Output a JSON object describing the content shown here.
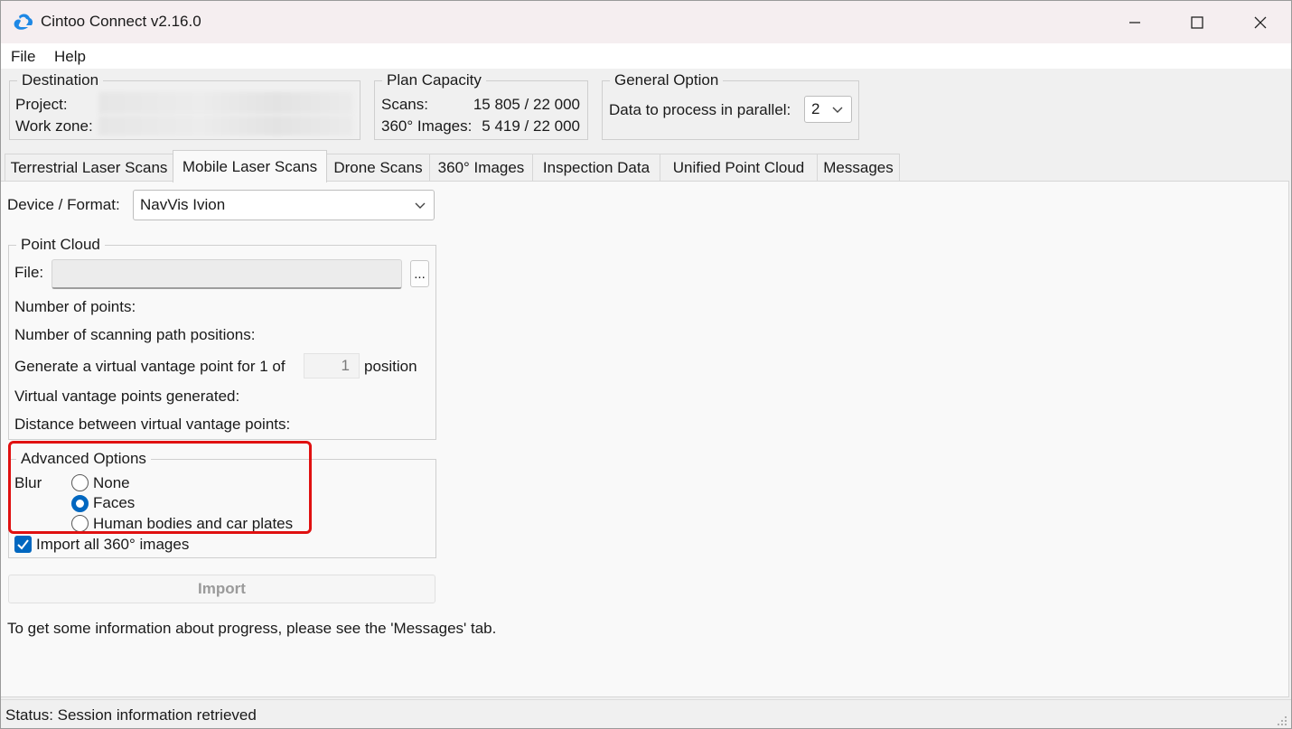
{
  "window": {
    "title": "Cintoo Connect v2.16.0",
    "colors": {
      "accent": "#0067c0",
      "highlight": "#e01010",
      "logo": "#1e88e5"
    }
  },
  "menu": {
    "file": "File",
    "help": "Help"
  },
  "destination": {
    "title": "Destination",
    "project_label": "Project:",
    "work_zone_label": "Work zone:"
  },
  "plan_capacity": {
    "title": "Plan Capacity",
    "scans_label": "Scans:",
    "scans_value": "15 805 / 22 000",
    "images_label": "360° Images:",
    "images_value": "5 419 / 22 000"
  },
  "general_option": {
    "title": "General Option",
    "parallel_label": "Data to process in parallel:",
    "parallel_value": "2"
  },
  "tabs": [
    {
      "label": "Terrestrial Laser Scans"
    },
    {
      "label": "Mobile Laser Scans"
    },
    {
      "label": "Drone Scans"
    },
    {
      "label": "360° Images"
    },
    {
      "label": "Inspection Data"
    },
    {
      "label": "Unified Point Cloud"
    },
    {
      "label": "Messages"
    }
  ],
  "mobile": {
    "device_label": "Device / Format:",
    "device_value": "NavVis Ivion",
    "point_cloud": {
      "title": "Point Cloud",
      "file_label": "File:",
      "browse_label": "...",
      "num_points_label": "Number of points:",
      "num_positions_label": "Number of scanning path positions:",
      "generate_prefix": "Generate a virtual vantage point for 1 of",
      "generate_value": "1",
      "generate_suffix": "position",
      "generated_label": "Virtual vantage points generated:",
      "distance_label": "Distance between virtual vantage points:"
    },
    "advanced": {
      "title": "Advanced Options",
      "blur_label": "Blur",
      "options": [
        "None",
        "Faces",
        "Human bodies and car plates"
      ],
      "selected": "Faces",
      "import_all_label": "Import all 360° images",
      "import_all_checked": true
    },
    "import_button": "Import",
    "info_text": "To get some information about progress, please see the 'Messages' tab."
  },
  "status": {
    "text": "Status: Session information retrieved"
  }
}
